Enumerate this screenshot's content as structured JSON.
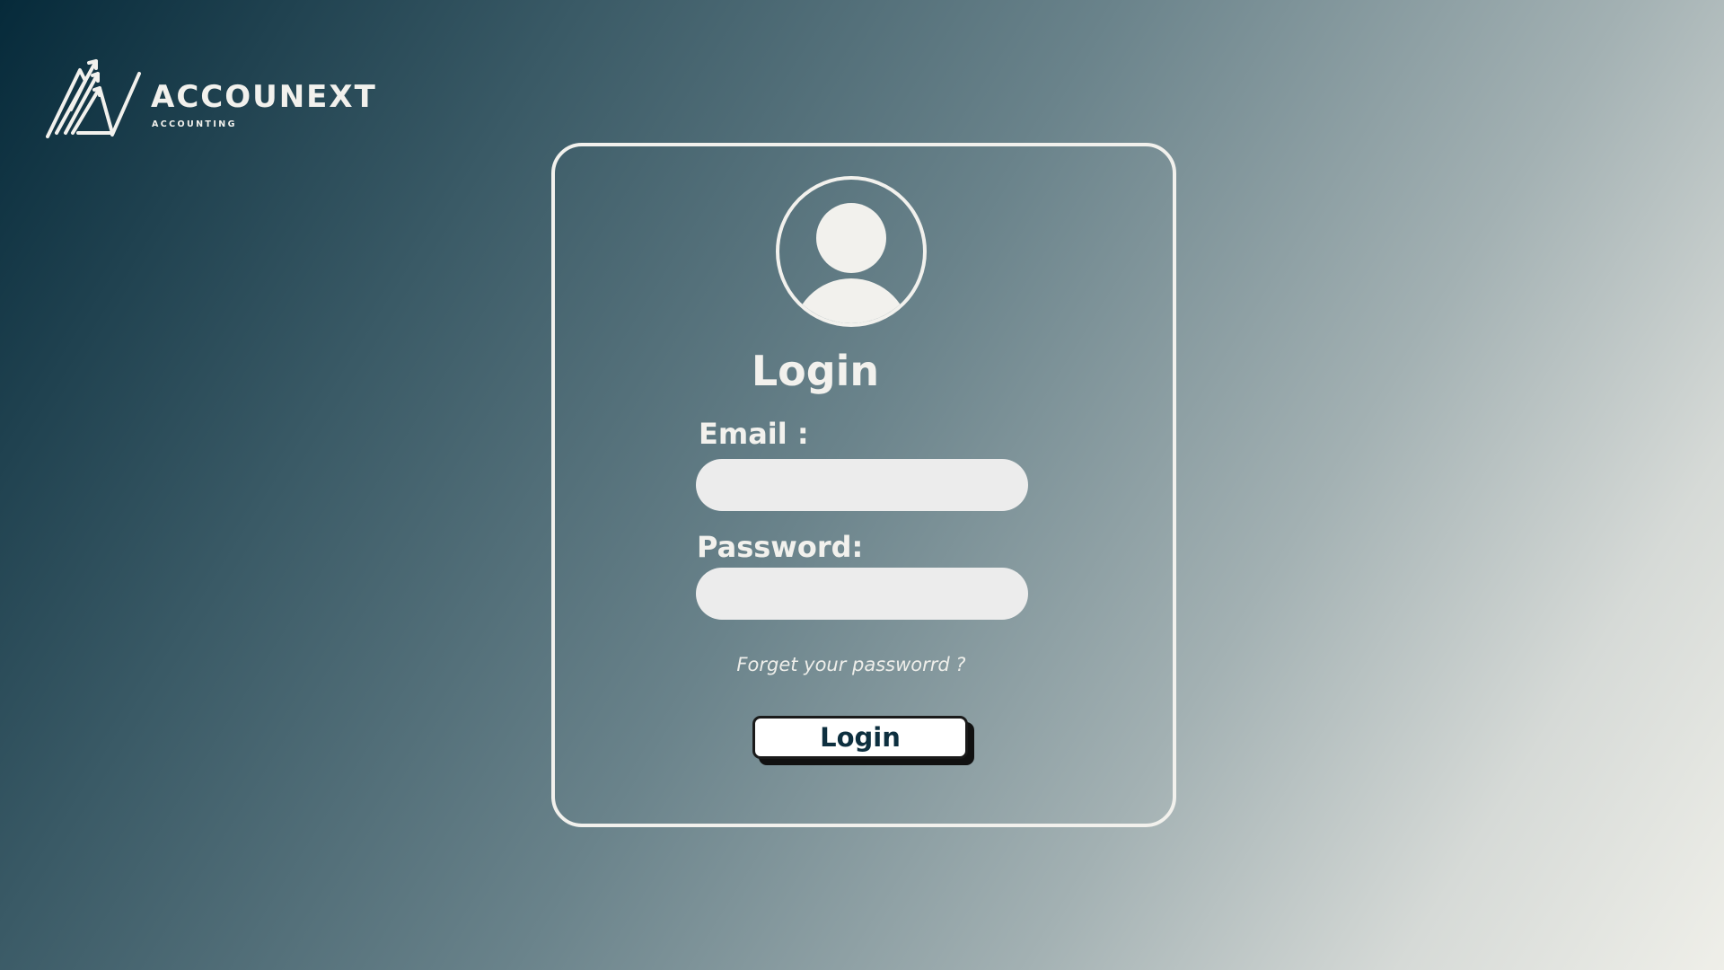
{
  "brand": {
    "name": "ACCOUNEXT",
    "tagline": "ACCOUNTING"
  },
  "login_form": {
    "title": "Login",
    "email_label": "Email :",
    "email_value": "",
    "password_label": "Password:",
    "password_value": "",
    "forgot_link": "Forget your passworrd ?",
    "submit_label": "Login"
  },
  "colors": {
    "background_start": "#062a3a",
    "background_end": "#efefe9",
    "foreground": "#f2f1ed",
    "button_text": "#0d2f3f"
  }
}
